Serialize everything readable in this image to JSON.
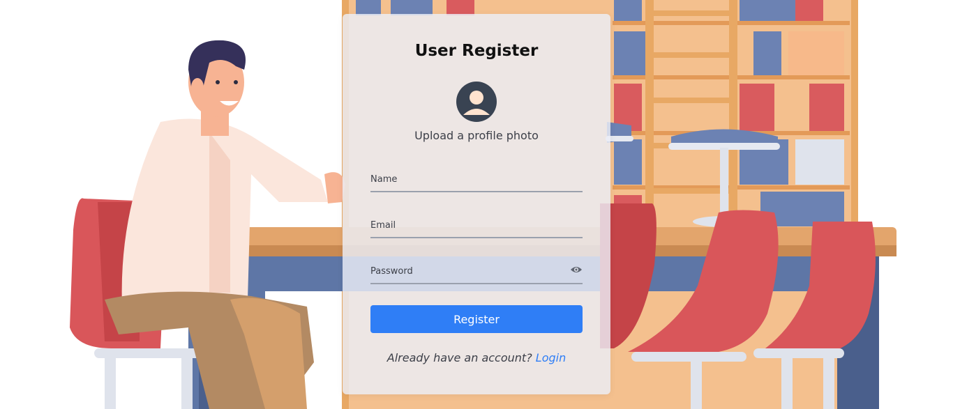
{
  "form": {
    "title": "User Register",
    "upload_label": "Upload a profile photo",
    "name_placeholder": "Name",
    "email_placeholder": "Email",
    "password_placeholder": "Password",
    "register_label": "Register",
    "have_account_text": "Already have an account?",
    "login_link": "Login"
  },
  "colors": {
    "accent": "#2f7ef6",
    "chair": "#d9565a",
    "table": "#e3a56c",
    "table_legs": "#5e76a6",
    "shelf": "#e8a864"
  },
  "icons": {
    "avatar": "user-circle-icon",
    "password_toggle": "eye-icon"
  }
}
